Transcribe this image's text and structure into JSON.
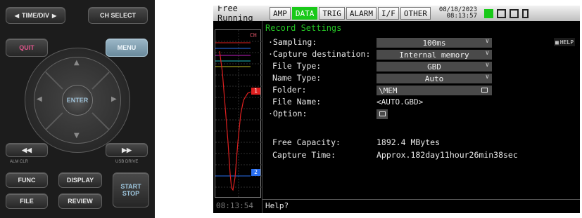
{
  "panel": {
    "time_div": "TIME/DIV",
    "ch_select": "CH SELECT",
    "quit": "QUIT",
    "menu": "MENU",
    "enter": "ENTER",
    "alm_clr": "ALM CLR",
    "usb_drive": "USB DRIVE",
    "func": "FUNC",
    "display": "DISPLAY",
    "file": "FILE",
    "review": "REVIEW",
    "start": "START",
    "stop": "STOP",
    "accent_color": "#e0568c",
    "menu_color": "#8aa8b8"
  },
  "screen": {
    "mode": "Free Running",
    "tabs": [
      "AMP",
      "DATA",
      "TRIG",
      "ALARM",
      "I/F",
      "OTHER"
    ],
    "active_tab": "DATA",
    "date": "08/18/2023",
    "time": "08:13:57",
    "clock": "08:13:54",
    "ch_label": "CH",
    "marker_1": "1",
    "marker_2": "2",
    "section_title": "Record Settings",
    "help_label": "HELP",
    "rows": {
      "sampling_label": "·Sampling:",
      "sampling_value": "100ms",
      "capture_label": "·Capture destination:",
      "capture_value": "Internal memory",
      "filetype_label": "File Type:",
      "filetype_value": "GBD",
      "nametype_label": "Name Type:",
      "nametype_value": "Auto",
      "folder_label": "Folder:",
      "folder_value": "\\MEM",
      "filename_label": "File Name:",
      "filename_value": "<AUTO.GBD>",
      "option_label": "·Option:"
    },
    "free_capacity_label": "Free Capacity:",
    "free_capacity_value": "1892.4 MBytes",
    "capture_time_label": "Capture Time:",
    "capture_time_value": "Approx.182day11hour26min38sec",
    "help_prompt": "Help?",
    "colors": {
      "active_tab": "#19c919",
      "title": "#25c425",
      "trace_1": "#e02020",
      "trace_2": "#2a6ff0"
    }
  }
}
